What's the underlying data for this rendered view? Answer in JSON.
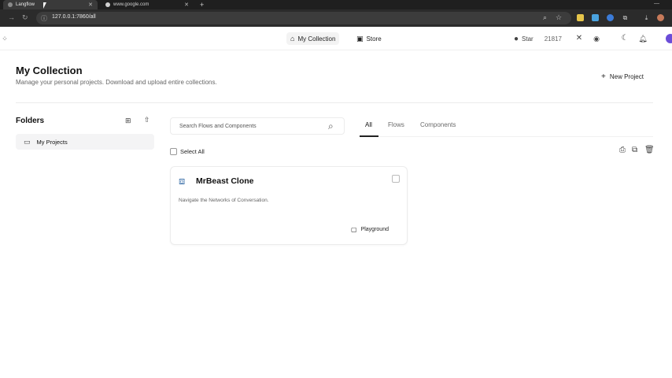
{
  "browser": {
    "tabs": [
      {
        "label": "Langflow",
        "active": true
      },
      {
        "label": "www.google.com",
        "active": false
      }
    ],
    "new_tab": "+",
    "url": "127.0.0.1:7860/all"
  },
  "header": {
    "nav": [
      {
        "label": "My Collection",
        "icon": "home-icon",
        "active": true
      },
      {
        "label": "Store",
        "icon": "store-icon",
        "active": false
      }
    ],
    "github": {
      "label": "Star",
      "count": "21817"
    }
  },
  "page": {
    "title": "My Collection",
    "subtitle": "Manage your personal projects. Download and upload entire collections.",
    "new_project_label": "New Project"
  },
  "sidebar": {
    "title": "Folders",
    "folders": [
      {
        "label": "My Projects"
      }
    ]
  },
  "main": {
    "search_placeholder": "Search Flows and Components",
    "tabs": [
      {
        "label": "All",
        "active": true
      },
      {
        "label": "Flows",
        "active": false
      },
      {
        "label": "Components",
        "active": false
      }
    ],
    "select_all_label": "Select All",
    "cards": [
      {
        "title": "MrBeast Clone",
        "description": "Navigate the Networks of Conversation.",
        "action_label": "Playground"
      }
    ]
  },
  "colors": {
    "chrome_dark": "#1f1f1f",
    "accent_dark": "#111111",
    "muted_text": "#666666"
  }
}
